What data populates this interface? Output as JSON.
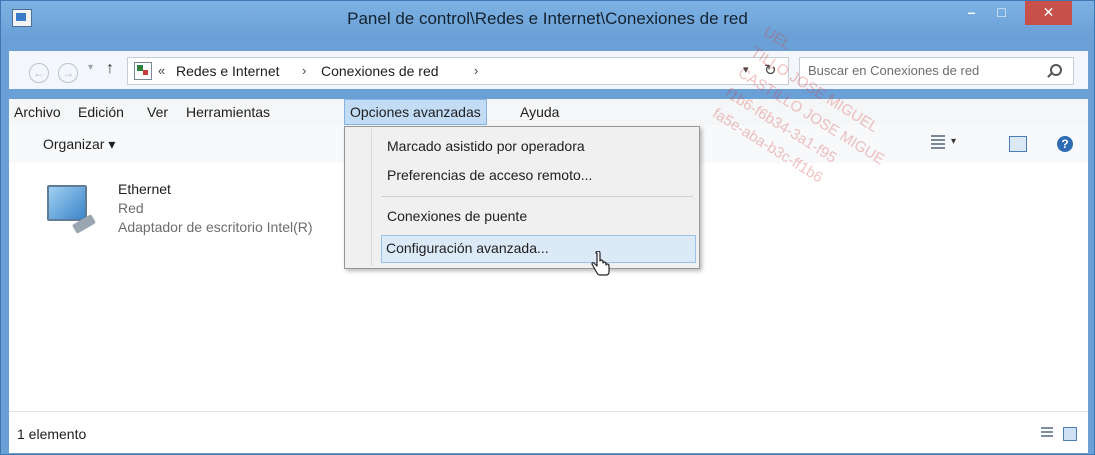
{
  "window": {
    "title": "Panel de control\\Redes e Internet\\Conexiones de red",
    "controls": {
      "minimize": "–",
      "maximize": "□",
      "close": "✕"
    }
  },
  "navigation": {
    "breadcrumb": [
      "«",
      "Redes e Internet",
      "›",
      "Conexiones de red",
      "›"
    ],
    "search_placeholder": "Buscar en Conexiones de red"
  },
  "menu": {
    "items": [
      "Archivo",
      "Edición",
      "Ver",
      "Herramientas",
      "Opciones avanzadas",
      "Ayuda"
    ],
    "active_index": 4
  },
  "dropdown": {
    "items": [
      "Marcado asistido por operadora",
      "Preferencias de acceso remoto...",
      "Conexiones de puente",
      "Configuración avanzada..."
    ],
    "hovered_index": 3
  },
  "toolbar": {
    "organize": "Organizar ▾"
  },
  "connection": {
    "name": "Ethernet",
    "status": "Red",
    "adapter": "Adaptador de escritorio Intel(R)"
  },
  "status": {
    "count": "1 elemento"
  },
  "watermark": {
    "lines": [
      "UEL",
      "TILLO JOSE MIGUEL",
      "CASTILLO JOSE MIGUE",
      "f1b6-f6b34-3a1-f95",
      "fa5e-aba-b3c-ff1b6"
    ]
  }
}
